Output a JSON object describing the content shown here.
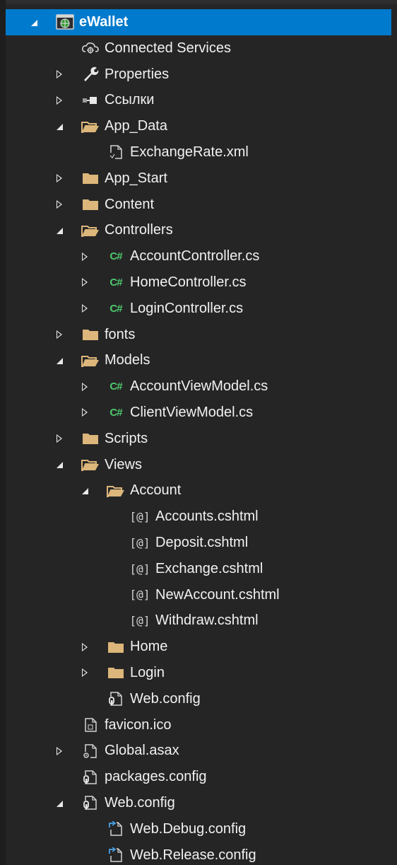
{
  "solution_explorer": {
    "items": [
      {
        "label": "eWallet",
        "level": 0,
        "state": "expanded",
        "icon": "web-project-icon",
        "selected": true
      },
      {
        "label": "Connected Services",
        "level": 1,
        "state": "none",
        "icon": "connected-services-icon"
      },
      {
        "label": "Properties",
        "level": 1,
        "state": "collapsed",
        "icon": "wrench-icon"
      },
      {
        "label": "Ссылки",
        "level": 1,
        "state": "collapsed",
        "icon": "references-icon"
      },
      {
        "label": "App_Data",
        "level": 1,
        "state": "expanded",
        "icon": "folder-open-icon"
      },
      {
        "label": "ExchangeRate.xml",
        "level": 2,
        "state": "none",
        "icon": "xml-file-icon"
      },
      {
        "label": "App_Start",
        "level": 1,
        "state": "collapsed",
        "icon": "folder-icon"
      },
      {
        "label": "Content",
        "level": 1,
        "state": "collapsed",
        "icon": "folder-icon"
      },
      {
        "label": "Controllers",
        "level": 1,
        "state": "expanded",
        "icon": "folder-open-icon"
      },
      {
        "label": "AccountController.cs",
        "level": 2,
        "state": "collapsed",
        "icon": "csharp-file-icon"
      },
      {
        "label": "HomeController.cs",
        "level": 2,
        "state": "collapsed",
        "icon": "csharp-file-icon"
      },
      {
        "label": "LoginController.cs",
        "level": 2,
        "state": "collapsed",
        "icon": "csharp-file-icon"
      },
      {
        "label": "fonts",
        "level": 1,
        "state": "collapsed",
        "icon": "folder-icon"
      },
      {
        "label": "Models",
        "level": 1,
        "state": "expanded",
        "icon": "folder-open-icon"
      },
      {
        "label": "AccountViewModel.cs",
        "level": 2,
        "state": "collapsed",
        "icon": "csharp-file-icon"
      },
      {
        "label": "ClientViewModel.cs",
        "level": 2,
        "state": "collapsed",
        "icon": "csharp-file-icon"
      },
      {
        "label": "Scripts",
        "level": 1,
        "state": "collapsed",
        "icon": "folder-icon"
      },
      {
        "label": "Views",
        "level": 1,
        "state": "expanded",
        "icon": "folder-open-icon"
      },
      {
        "label": "Account",
        "level": 2,
        "state": "expanded",
        "icon": "folder-open-icon"
      },
      {
        "label": "Accounts.cshtml",
        "level": 3,
        "state": "none",
        "icon": "razor-file-icon"
      },
      {
        "label": "Deposit.cshtml",
        "level": 3,
        "state": "none",
        "icon": "razor-file-icon"
      },
      {
        "label": "Exchange.cshtml",
        "level": 3,
        "state": "none",
        "icon": "razor-file-icon"
      },
      {
        "label": "NewAccount.cshtml",
        "level": 3,
        "state": "none",
        "icon": "razor-file-icon"
      },
      {
        "label": "Withdraw.cshtml",
        "level": 3,
        "state": "none",
        "icon": "razor-file-icon"
      },
      {
        "label": "Home",
        "level": 2,
        "state": "collapsed",
        "icon": "folder-icon"
      },
      {
        "label": "Login",
        "level": 2,
        "state": "collapsed",
        "icon": "folder-icon"
      },
      {
        "label": "Web.config",
        "level": 2,
        "state": "none",
        "icon": "config-file-icon"
      },
      {
        "label": "favicon.ico",
        "level": 1,
        "state": "none",
        "icon": "ico-file-icon"
      },
      {
        "label": "Global.asax",
        "level": 1,
        "state": "collapsed",
        "icon": "asax-file-icon"
      },
      {
        "label": "packages.config",
        "level": 1,
        "state": "none",
        "icon": "config-file-icon"
      },
      {
        "label": "Web.config",
        "level": 1,
        "state": "expanded",
        "icon": "config-file-icon"
      },
      {
        "label": "Web.Debug.config",
        "level": 2,
        "state": "none",
        "icon": "config-transform-icon"
      },
      {
        "label": "Web.Release.config",
        "level": 2,
        "state": "none",
        "icon": "config-transform-icon"
      }
    ]
  },
  "colors": {
    "background": "#252526",
    "selection": "#007acc",
    "text": "#f1f1f1",
    "folder": "#dcb67a",
    "csharp": "#4ec96b"
  }
}
